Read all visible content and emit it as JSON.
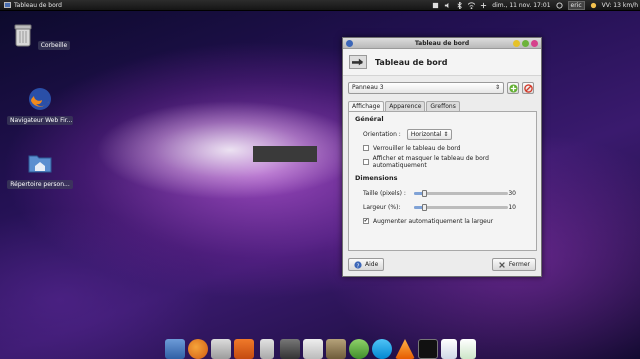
{
  "top_panel": {
    "task_title": "Tableau de bord",
    "datetime": "dim., 11 nov.  17:01",
    "user": "eric",
    "weather": "VV: 13 km/h"
  },
  "desktop": {
    "icons": [
      {
        "label": "Corbeille",
        "icon": "trash-icon"
      },
      {
        "label": "Navigateur Web Fir...",
        "icon": "firefox-icon"
      },
      {
        "label": "Répertoire person...",
        "icon": "home-folder-icon"
      }
    ]
  },
  "window": {
    "title": "Tableau de bord",
    "header_title": "Tableau de bord",
    "panel_select": "Panneau 3",
    "tabs": [
      "Affichage",
      "Apparence",
      "Greffons"
    ],
    "general": {
      "title": "Général",
      "orientation_label": "Orientation :",
      "orientation_value": "Horizontal",
      "lock_label": "Verrouiller le tableau de bord",
      "lock_checked": false,
      "autohide_label": "Afficher et masquer le tableau de bord automatiquement",
      "autohide_checked": false
    },
    "dimensions": {
      "title": "Dimensions",
      "size_label": "Taille (pixels) :",
      "size_value": "30",
      "size_fraction": 0.1,
      "width_label": "Largeur (%):",
      "width_value": "10",
      "width_fraction": 0.1,
      "autogrow_label": "Augmenter automatiquement la largeur",
      "autogrow_checked": true
    },
    "help_button": "Aide",
    "close_button": "Fermer"
  },
  "dock": {
    "items": [
      "workspace-icon",
      "firefox-icon",
      "settings-icon",
      "box-icon",
      "trash-icon",
      "calculator-icon",
      "pen-icon",
      "gimp-icon",
      "people-icon",
      "skype-icon",
      "vlc-icon",
      "terminal-icon",
      "document-icon",
      "spreadsheet-icon"
    ]
  },
  "colors": {
    "accent": "#3b66b8",
    "add_green": "#5fae2e",
    "remove_red": "#d23a2a"
  }
}
